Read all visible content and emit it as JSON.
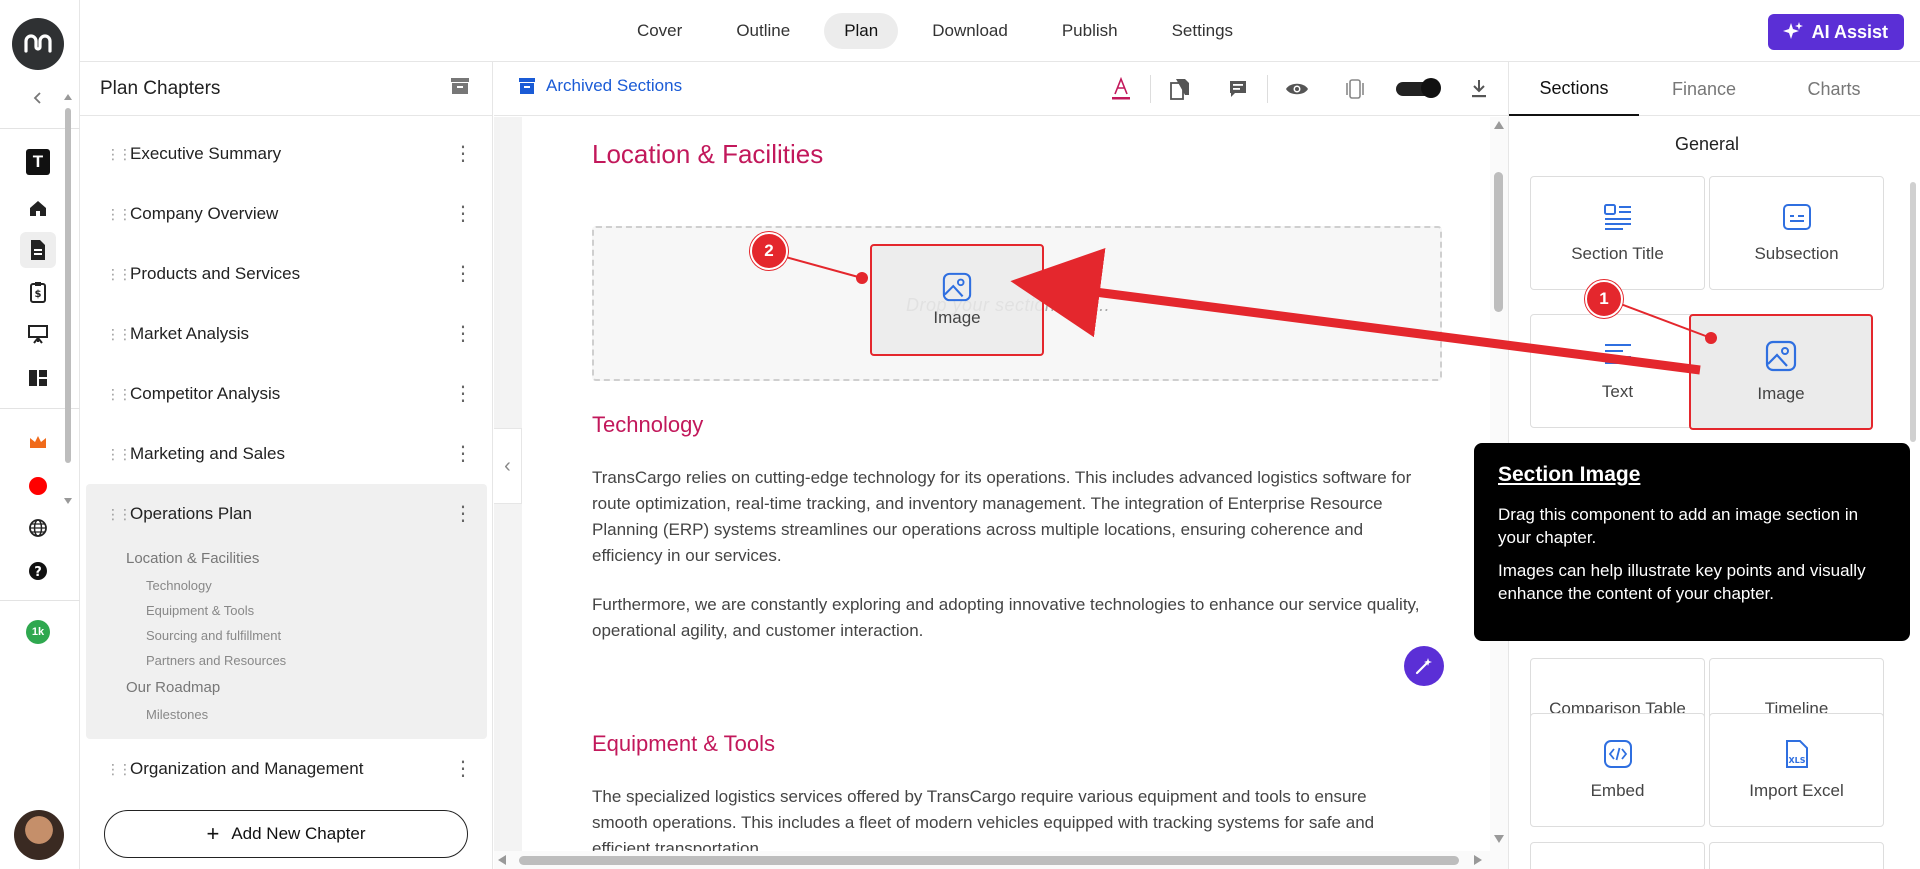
{
  "nav": {
    "tabs": [
      "Cover",
      "Outline",
      "Plan",
      "Download",
      "Publish",
      "Settings"
    ],
    "active_tab": "Plan",
    "ai_assist_label": "AI Assist"
  },
  "rail": {
    "workspace_letter": "T",
    "count_badge": "1k"
  },
  "chapters": {
    "title": "Plan Chapters",
    "items": [
      {
        "label": "Executive Summary"
      },
      {
        "label": "Company Overview"
      },
      {
        "label": "Products and Services"
      },
      {
        "label": "Market Analysis"
      },
      {
        "label": "Competitor Analysis"
      },
      {
        "label": "Marketing and Sales"
      },
      {
        "label": "Operations Plan"
      },
      {
        "label": "Organization and Management"
      }
    ],
    "active_subsections": [
      {
        "label": "Location & Facilities",
        "level": 1
      },
      {
        "label": "Technology",
        "level": 2
      },
      {
        "label": "Equipment & Tools",
        "level": 2
      },
      {
        "label": "Sourcing and fulfillment",
        "level": 2
      },
      {
        "label": "Partners and Resources",
        "level": 2
      },
      {
        "label": "Our Roadmap",
        "level": 1
      },
      {
        "label": "Milestones",
        "level": 2
      }
    ],
    "add_button": "Add New Chapter"
  },
  "toolbar": {
    "archived_label": "Archived Sections"
  },
  "editor": {
    "section_title": "Location & Facilities",
    "drop_placeholder": "Drop your section here..",
    "dragged_card_label": "Image",
    "tech_heading": "Technology",
    "tech_p1": "TransCargo relies on cutting-edge technology for its operations. This includes advanced logistics software for route optimization, real-time tracking, and inventory management. The integration of Enterprise Resource Planning (ERP) systems streamlines our operations across multiple locations, ensuring coherence and efficiency in our services.",
    "tech_p2": "Furthermore, we are constantly exploring and adopting innovative technologies to enhance our service quality, operational agility, and customer interaction.",
    "equip_heading": "Equipment & Tools",
    "equip_p1": "The specialized logistics services offered by TransCargo require various equipment and tools to ensure smooth operations. This includes a fleet of modern vehicles equipped with tracking systems for safe and efficient transportation."
  },
  "components": {
    "tabs": [
      "Sections",
      "Finance",
      "Charts"
    ],
    "active_tab": "Sections",
    "group_title": "General",
    "cards": [
      "Section Title",
      "Subsection",
      "Text",
      "Image",
      "Comparison Table",
      "Timeline",
      "Embed",
      "Import Excel"
    ]
  },
  "tooltip": {
    "title": "Section Image",
    "p1": "Drag this component to add an image section in your chapter.",
    "p2": "Images can help illustrate key points and visually enhance the content of your chapter."
  },
  "annotations": {
    "step1": "1",
    "step2": "2",
    "accent_color": "#e4272d"
  },
  "colors": {
    "brand_purple": "#5b2fd6",
    "heading_pink": "#c2185b",
    "link_blue": "#1a5bd6",
    "icon_blue": "#2f6fe0"
  }
}
